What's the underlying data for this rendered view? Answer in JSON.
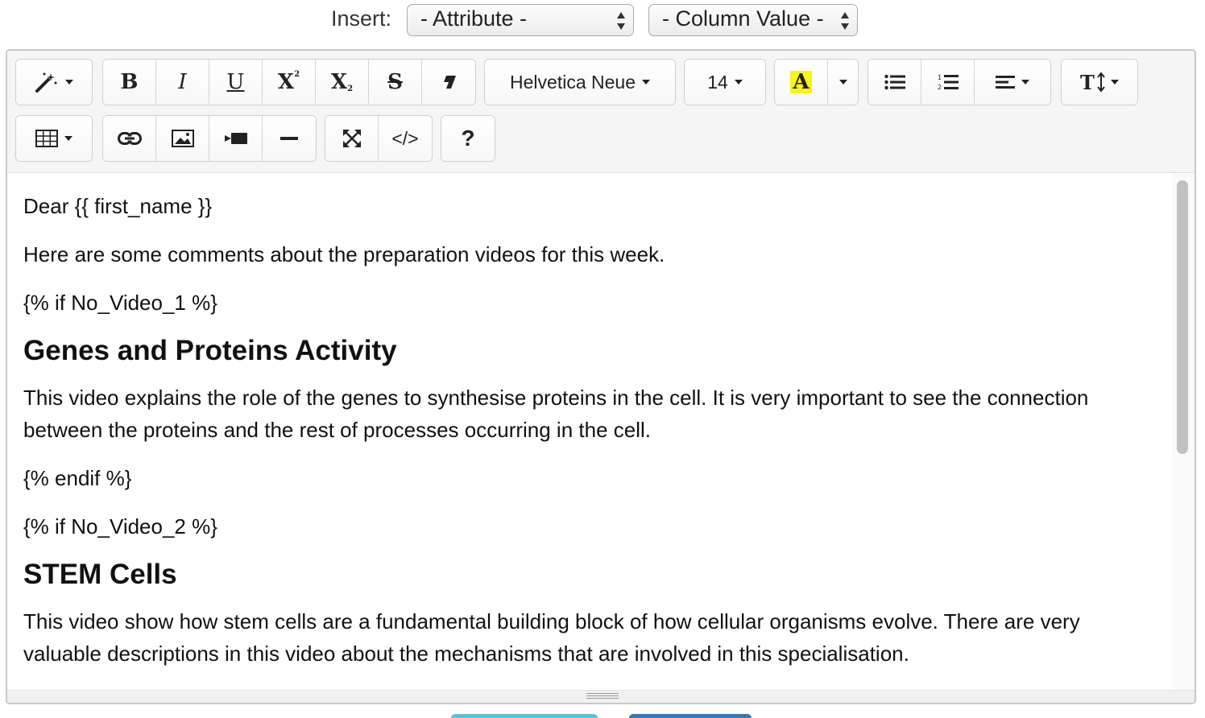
{
  "insert": {
    "label": "Insert:",
    "attribute_select": "- Attribute -",
    "column_select": "- Column Value -"
  },
  "toolbar": {
    "magic_icon": "magic-wand-icon",
    "bold": "B",
    "italic": "I",
    "underline": "U",
    "superscript": "X",
    "subscript": "X",
    "strike": "S",
    "font_family": "Helvetica Neue",
    "font_size": "14",
    "highlight": "A",
    "help": "?",
    "code": "</>"
  },
  "content": {
    "greeting": "Dear {{ first_name }}",
    "intro": "Here are some comments about the preparation videos for this week.",
    "if1": "{% if No_Video_1 %}",
    "heading1": "Genes and Proteins Activity",
    "para1": "This video explains the role of the genes to synthesise proteins in the cell. It is very important to see the connection between the proteins and the rest of processes occurring in the cell.",
    "endif1": "{% endif %}",
    "if2": "{% if No_Video_2 %}",
    "heading2": "STEM Cells",
    "para2": "This video show how stem cells are a fundamental building block of how cellular organisms evolve. There are very valuable descriptions in this video about the mechanisms that are involved in this specialisation."
  },
  "colors": {
    "highlight_yellow": "#f7f31c",
    "button_teal": "#5bc0de",
    "button_blue": "#337ab7"
  }
}
